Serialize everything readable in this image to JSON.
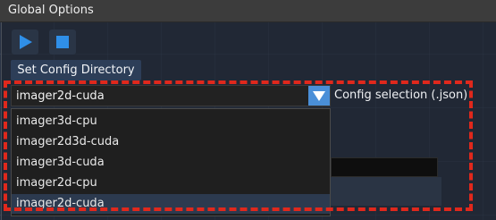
{
  "window": {
    "title": "Global Options"
  },
  "toolbar": {
    "play_icon": "play-icon",
    "stop_icon": "stop-icon",
    "accent_color": "#2f8fe8"
  },
  "config_directory_button": {
    "label": "Set Config Directory"
  },
  "config_selection": {
    "selected_value": "imager2d-cuda",
    "caption": "Config selection (.json)",
    "options": [
      "imager3d-cpu",
      "imager2d3d-cuda",
      "imager3d-cuda",
      "imager2d-cpu",
      "imager2d-cuda"
    ]
  },
  "highlight_color": "#e0281c"
}
